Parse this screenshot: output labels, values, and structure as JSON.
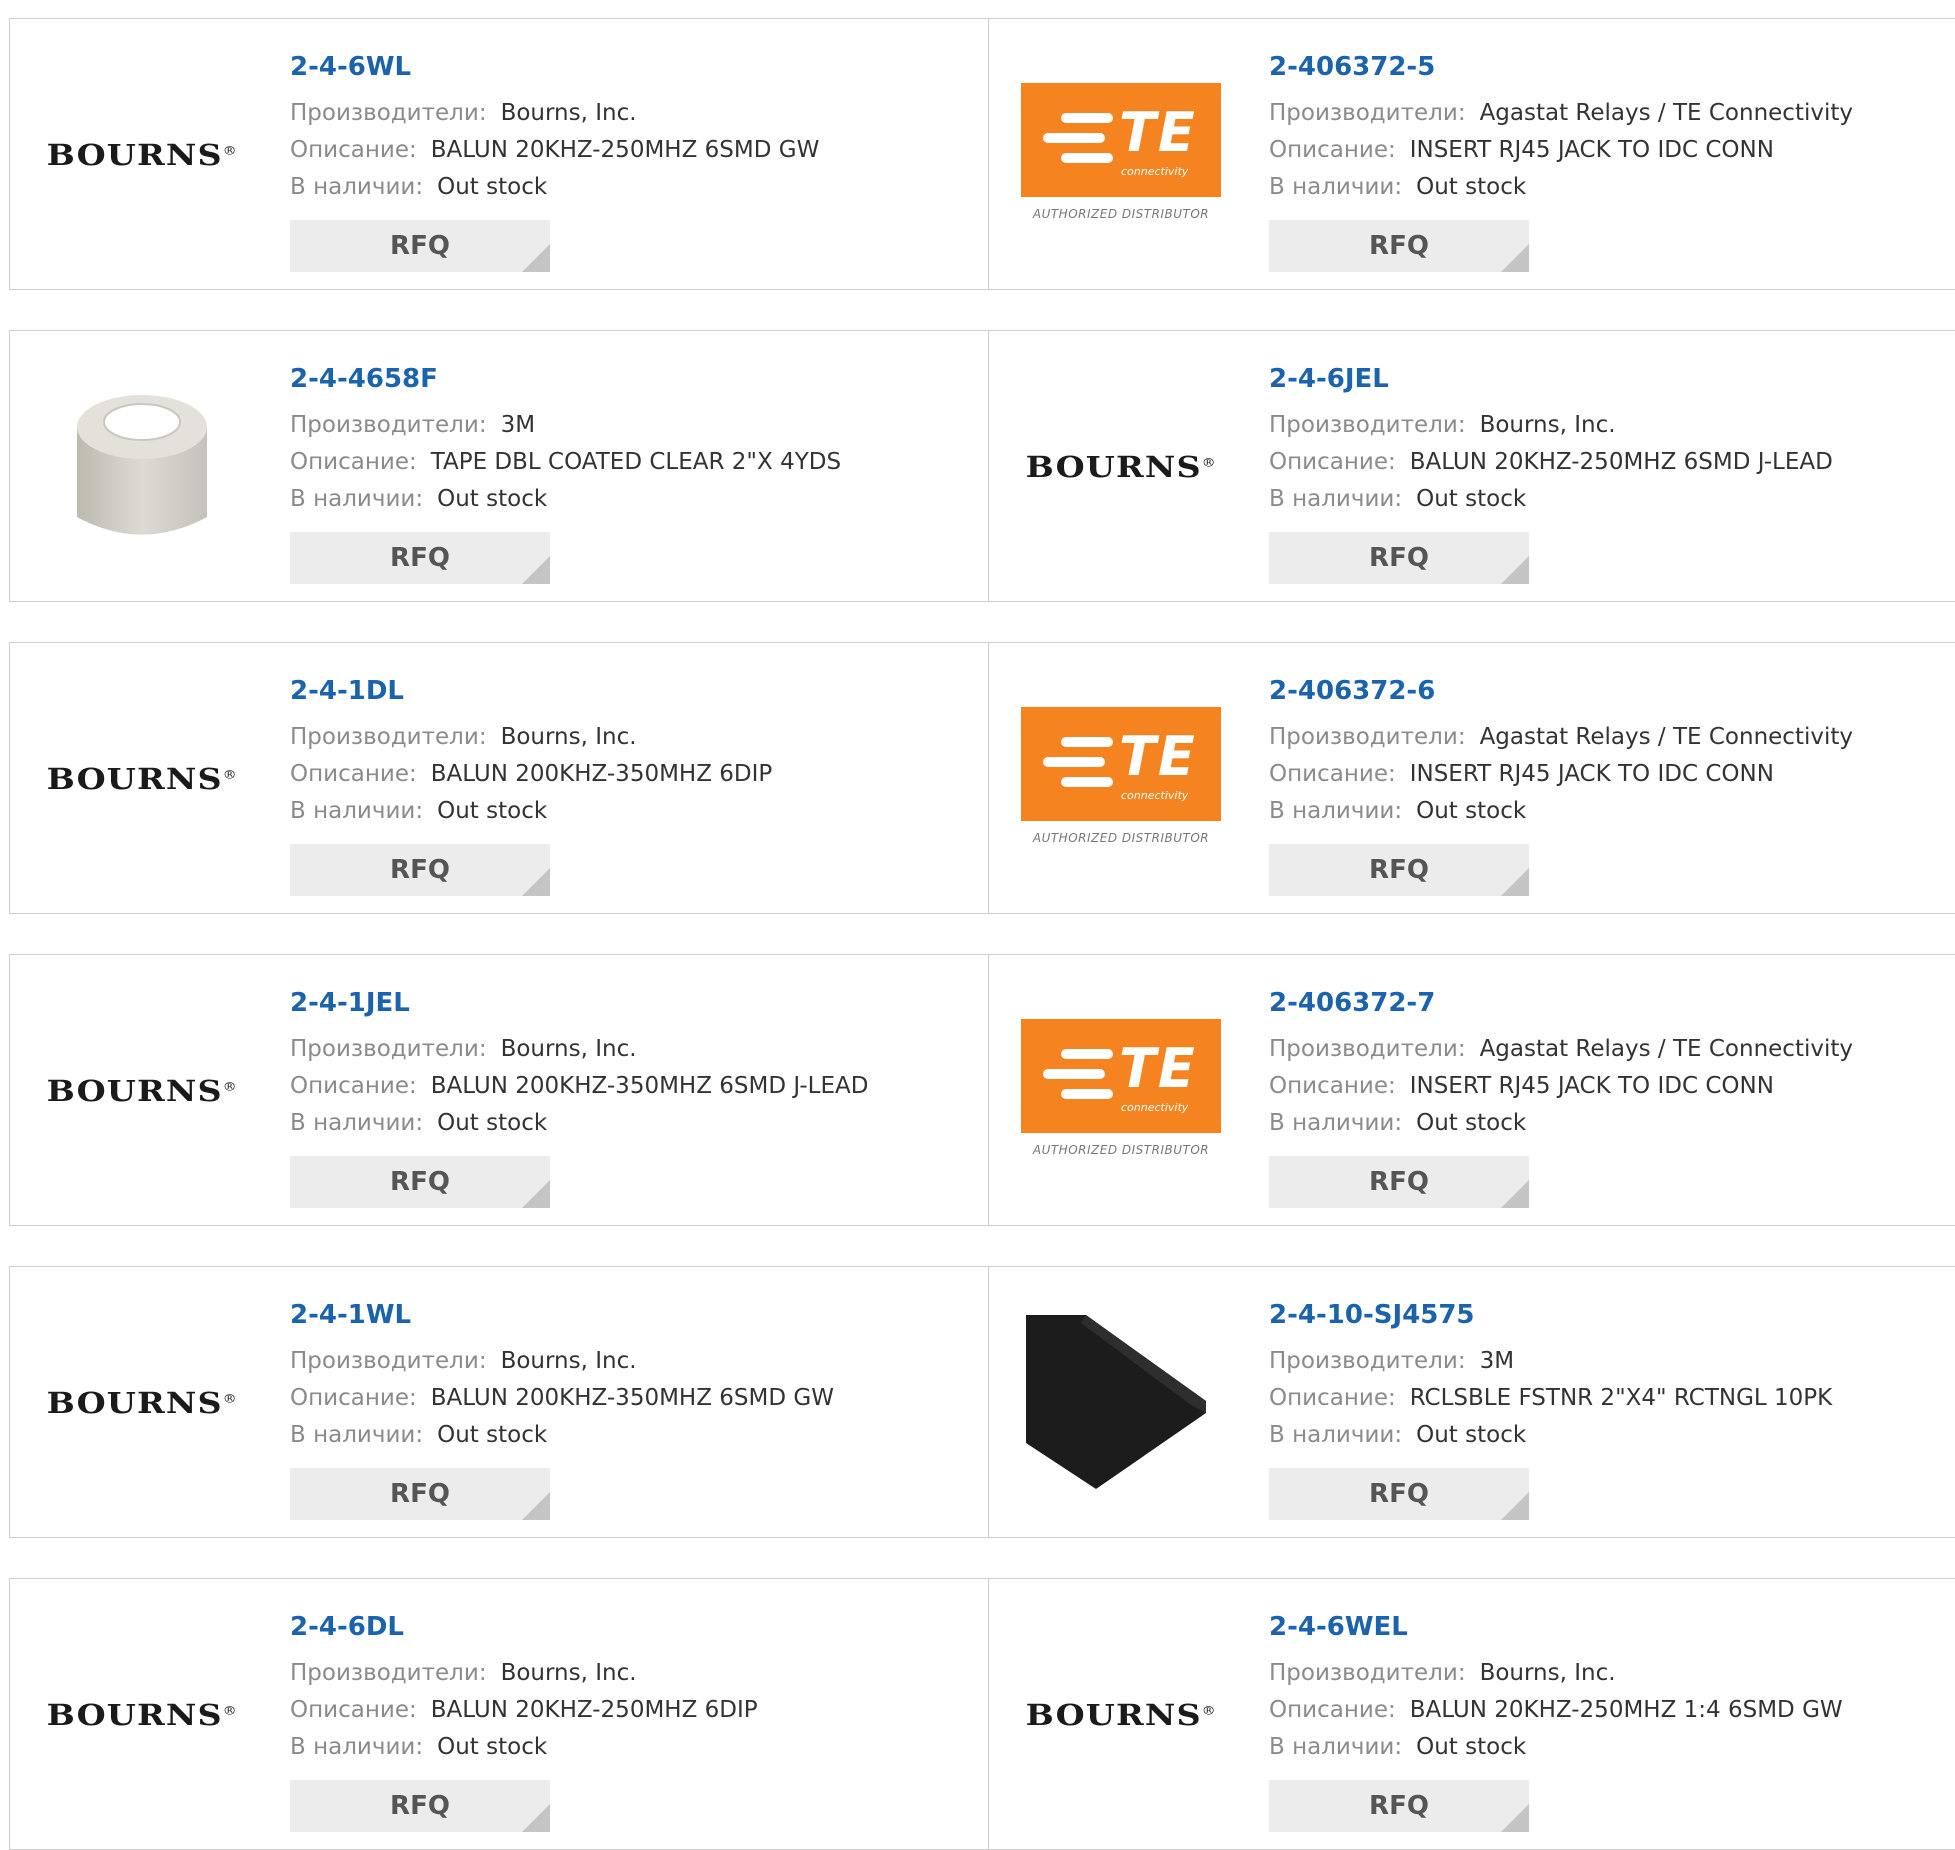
{
  "labels": {
    "manufacturer": "Производители:",
    "description": "Описание:",
    "stock": "В наличии:",
    "rfq": "RFQ"
  },
  "logo_texts": {
    "bourns": "BOURNS",
    "bourns_mark": "®",
    "te": "TE",
    "te_sub": "connectivity",
    "te_authorized": "AUTHORIZED DISTRIBUTOR"
  },
  "colors": {
    "part_link": "#1b63ad",
    "te_orange": "#f58320",
    "rfq_bg": "#ececec"
  },
  "products": [
    {
      "part": "2-4-6WL",
      "manufacturer": "Bourns, Inc.",
      "description": "BALUN 20KHZ-250MHZ 6SMD GW",
      "stock": "Out stock",
      "logo": "bourns-logo"
    },
    {
      "part": "2-406372-5",
      "manufacturer": "Agastat Relays / TE Connectivity",
      "description": "INSERT RJ45 JACK TO IDC CONN",
      "stock": "Out stock",
      "logo": "te-connectivity-logo"
    },
    {
      "part": "2-4-4658F",
      "manufacturer": "3M",
      "description": "TAPE DBL COATED CLEAR 2\"X 4YDS",
      "stock": "Out stock",
      "logo": "tape-roll-image"
    },
    {
      "part": "2-4-6JEL",
      "manufacturer": "Bourns, Inc.",
      "description": "BALUN 20KHZ-250MHZ 6SMD J-LEAD",
      "stock": "Out stock",
      "logo": "bourns-logo"
    },
    {
      "part": "2-4-1DL",
      "manufacturer": "Bourns, Inc.",
      "description": "BALUN 200KHZ-350MHZ 6DIP",
      "stock": "Out stock",
      "logo": "bourns-logo"
    },
    {
      "part": "2-406372-6",
      "manufacturer": "Agastat Relays / TE Connectivity",
      "description": "INSERT RJ45 JACK TO IDC CONN",
      "stock": "Out stock",
      "logo": "te-connectivity-logo"
    },
    {
      "part": "2-4-1JEL",
      "manufacturer": "Bourns, Inc.",
      "description": "BALUN 200KHZ-350MHZ 6SMD J-LEAD",
      "stock": "Out stock",
      "logo": "bourns-logo"
    },
    {
      "part": "2-406372-7",
      "manufacturer": "Agastat Relays / TE Connectivity",
      "description": "INSERT RJ45 JACK TO IDC CONN",
      "stock": "Out stock",
      "logo": "te-connectivity-logo"
    },
    {
      "part": "2-4-1WL",
      "manufacturer": "Bourns, Inc.",
      "description": "BALUN 200KHZ-350MHZ 6SMD GW",
      "stock": "Out stock",
      "logo": "bourns-logo"
    },
    {
      "part": "2-4-10-SJ4575",
      "manufacturer": "3M",
      "description": "RCLSBLE FSTNR 2\"X4\" RCTNGL 10PK",
      "stock": "Out stock",
      "logo": "fastener-strip-image"
    },
    {
      "part": "2-4-6DL",
      "manufacturer": "Bourns, Inc.",
      "description": "BALUN 20KHZ-250MHZ 6DIP",
      "stock": "Out stock",
      "logo": "bourns-logo"
    },
    {
      "part": "2-4-6WEL",
      "manufacturer": "Bourns, Inc.",
      "description": "BALUN 20KHZ-250MHZ 1:4 6SMD GW",
      "stock": "Out stock",
      "logo": "bourns-logo"
    }
  ]
}
